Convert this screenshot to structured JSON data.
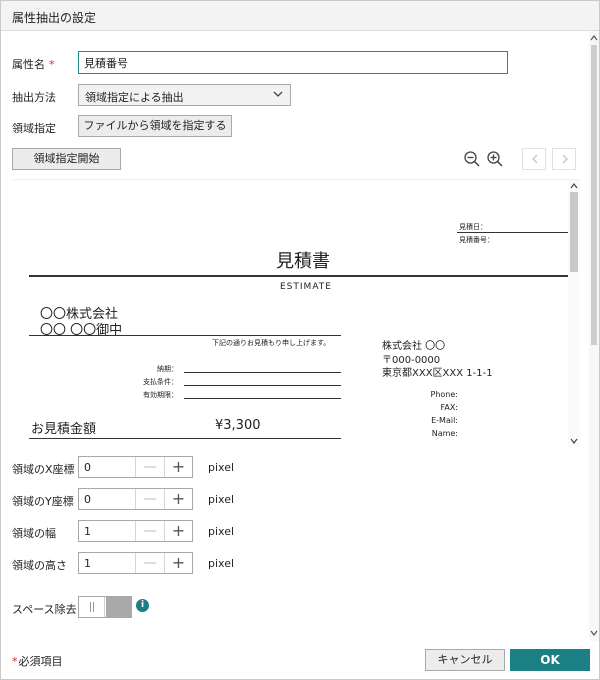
{
  "dialog": {
    "title": "属性抽出の設定"
  },
  "form": {
    "attribute_name": {
      "label": "属性名",
      "required_mark": "*",
      "value": "見積番号"
    },
    "method": {
      "label": "抽出方法",
      "value": "領域指定による抽出"
    },
    "region": {
      "label": "領域指定",
      "button": "ファイルから領域を指定する"
    },
    "start_button": "領域指定開始"
  },
  "preview": {
    "quote_date_label": "見積日：",
    "quote_no_label": "見積番号：",
    "doc_title": "見積書",
    "doc_subtitle": "ESTIMATE",
    "customer_line1": "〇〇株式会社",
    "customer_line2": "〇〇 〇〇御中",
    "intro": "下記の通りお見積もり申し上げます。",
    "delivery_label": "納期：",
    "payment_label": "支払条件：",
    "validity_label": "有効期限：",
    "total_label": "お見積金額",
    "total_value": "¥3,300",
    "company_name": "株式会社 〇〇",
    "postal": "〒000-0000",
    "address": "東京都XXX区XXX 1-1-1",
    "phone_label": "Phone:",
    "fax_label": "FAX:",
    "email_label": "E-Mail:",
    "name_label": "Name:"
  },
  "coords": {
    "x": {
      "label": "領域のX座標",
      "value": "0"
    },
    "y": {
      "label": "領域のY座標",
      "value": "0"
    },
    "width": {
      "label": "領域の幅",
      "value": "1"
    },
    "height": {
      "label": "領域の高さ",
      "value": "1"
    },
    "unit": "pixel",
    "minus": "—",
    "plus": "+"
  },
  "space_removal": {
    "label": "スペース除去",
    "info": "i"
  },
  "footer": {
    "required_mark": "*",
    "required_note": "必須項目",
    "cancel": "キャンセル",
    "ok": "OK"
  },
  "colors": {
    "accent": "#1b7f84",
    "required": "#dd2222"
  }
}
